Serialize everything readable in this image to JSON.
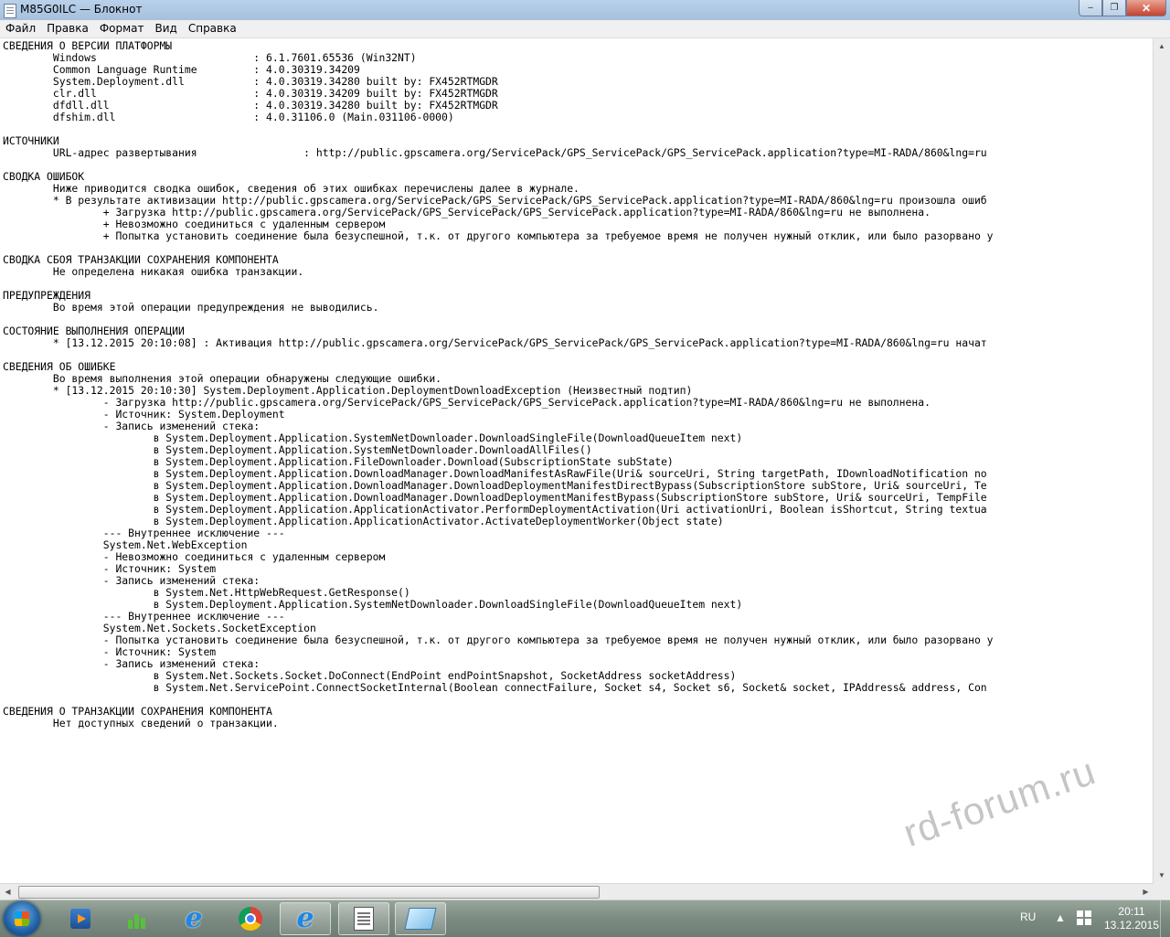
{
  "window": {
    "title": "M85G0ILC — Блокнот",
    "controls": {
      "minimize": "‒",
      "maximize": "❐",
      "close": "✕"
    }
  },
  "menu": [
    "Файл",
    "Правка",
    "Формат",
    "Вид",
    "Справка"
  ],
  "document_lines": [
    "СВЕДЕНИЯ О ВЕРСИИ ПЛАТФОРМЫ",
    "\tWindows \t\t\t: 6.1.7601.65536 (Win32NT)",
    "\tCommon Language Runtime \t: 4.0.30319.34209",
    "\tSystem.Deployment.dll \t\t: 4.0.30319.34280 built by: FX452RTMGDR",
    "\tclr.dll \t\t\t: 4.0.30319.34209 built by: FX452RTMGDR",
    "\tdfdll.dll \t\t\t: 4.0.30319.34280 built by: FX452RTMGDR",
    "\tdfshim.dll \t\t\t: 4.0.31106.0 (Main.031106-0000)",
    "",
    "ИСТОЧНИКИ",
    "\tURL-адрес развертывания\t\t\t: http://public.gpscamera.org/ServicePack/GPS_ServicePack/GPS_ServicePack.application?type=MI-RADA/860&lng=ru",
    "",
    "СВОДКА ОШИБОК",
    "\tНиже приводится сводка ошибок, сведения об этих ошибках перечислены далее в журнале.",
    "\t* В результате активизации http://public.gpscamera.org/ServicePack/GPS_ServicePack/GPS_ServicePack.application?type=MI-RADA/860&lng=ru произошла ошиб",
    "\t\t+ Загрузка http://public.gpscamera.org/ServicePack/GPS_ServicePack/GPS_ServicePack.application?type=MI-RADA/860&lng=ru не выполнена.",
    "\t\t+ Невозможно соединиться с удаленным сервером",
    "\t\t+ Попытка установить соединение была безуспешной, т.к. от другого компьютера за требуемое время не получен нужный отклик, или было разорвано у",
    "",
    "СВОДКА СБОЯ ТРАНЗАКЦИИ СОХРАНЕНИЯ КОМПОНЕНТА",
    "\tНе определена никакая ошибка транзакции.",
    "",
    "ПРЕДУПРЕЖДЕНИЯ",
    "\tВо время этой операции предупреждения не выводились.",
    "",
    "СОСТОЯНИЕ ВЫПОЛНЕНИЯ ОПЕРАЦИИ",
    "\t* [13.12.2015 20:10:08] : Активация http://public.gpscamera.org/ServicePack/GPS_ServicePack/GPS_ServicePack.application?type=MI-RADA/860&lng=ru начат",
    "",
    "СВЕДЕНИЯ ОБ ОШИБКЕ",
    "\tВо время выполнения этой операции обнаружены следующие ошибки.",
    "\t* [13.12.2015 20:10:30] System.Deployment.Application.DeploymentDownloadException (Неизвестный подтип)",
    "\t\t- Загрузка http://public.gpscamera.org/ServicePack/GPS_ServicePack/GPS_ServicePack.application?type=MI-RADA/860&lng=ru не выполнена.",
    "\t\t- Источник: System.Deployment",
    "\t\t- Запись изменений стека:",
    "\t\t\tв System.Deployment.Application.SystemNetDownloader.DownloadSingleFile(DownloadQueueItem next)",
    "\t\t\tв System.Deployment.Application.SystemNetDownloader.DownloadAllFiles()",
    "\t\t\tв System.Deployment.Application.FileDownloader.Download(SubscriptionState subState)",
    "\t\t\tв System.Deployment.Application.DownloadManager.DownloadManifestAsRawFile(Uri& sourceUri, String targetPath, IDownloadNotification no",
    "\t\t\tв System.Deployment.Application.DownloadManager.DownloadDeploymentManifestDirectBypass(SubscriptionStore subStore, Uri& sourceUri, Te",
    "\t\t\tв System.Deployment.Application.DownloadManager.DownloadDeploymentManifestBypass(SubscriptionStore subStore, Uri& sourceUri, TempFile",
    "\t\t\tв System.Deployment.Application.ApplicationActivator.PerformDeploymentActivation(Uri activationUri, Boolean isShortcut, String textua",
    "\t\t\tв System.Deployment.Application.ApplicationActivator.ActivateDeploymentWorker(Object state)",
    "\t\t--- Внутреннее исключение ---",
    "\t\tSystem.Net.WebException",
    "\t\t- Невозможно соединиться с удаленным сервером",
    "\t\t- Источник: System",
    "\t\t- Запись изменений стека:",
    "\t\t\tв System.Net.HttpWebRequest.GetResponse()",
    "\t\t\tв System.Deployment.Application.SystemNetDownloader.DownloadSingleFile(DownloadQueueItem next)",
    "\t\t--- Внутреннее исключение ---",
    "\t\tSystem.Net.Sockets.SocketException",
    "\t\t- Попытка установить соединение была безуспешной, т.к. от другого компьютера за требуемое время не получен нужный отклик, или было разорвано у",
    "\t\t- Источник: System",
    "\t\t- Запись изменений стека:",
    "\t\t\tв System.Net.Sockets.Socket.DoConnect(EndPoint endPointSnapshot, SocketAddress socketAddress)",
    "\t\t\tв System.Net.ServicePoint.ConnectSocketInternal(Boolean connectFailure, Socket s4, Socket s6, Socket& socket, IPAddress& address, Con",
    "",
    "СВЕДЕНИЯ О ТРАНЗАКЦИИ СОХРАНЕНИЯ КОМПОНЕНТА",
    "\tНет доступных сведений о транзакции."
  ],
  "taskbar": {
    "items": [
      {
        "name": "media-player",
        "icon": "media-player-icon"
      },
      {
        "name": "task-manager",
        "icon": "chart-icon"
      },
      {
        "name": "internet-explorer",
        "icon": "ie-icon"
      },
      {
        "name": "chrome",
        "icon": "chrome-icon"
      },
      {
        "name": "internet-explorer-2",
        "icon": "ie-icon"
      },
      {
        "name": "notepad",
        "icon": "notepad-icon"
      },
      {
        "name": "editor",
        "icon": "editor-icon"
      }
    ],
    "tray": {
      "language": "RU",
      "time": "20:11",
      "date": "13.12.2015"
    }
  },
  "watermark": "rd-forum.ru"
}
